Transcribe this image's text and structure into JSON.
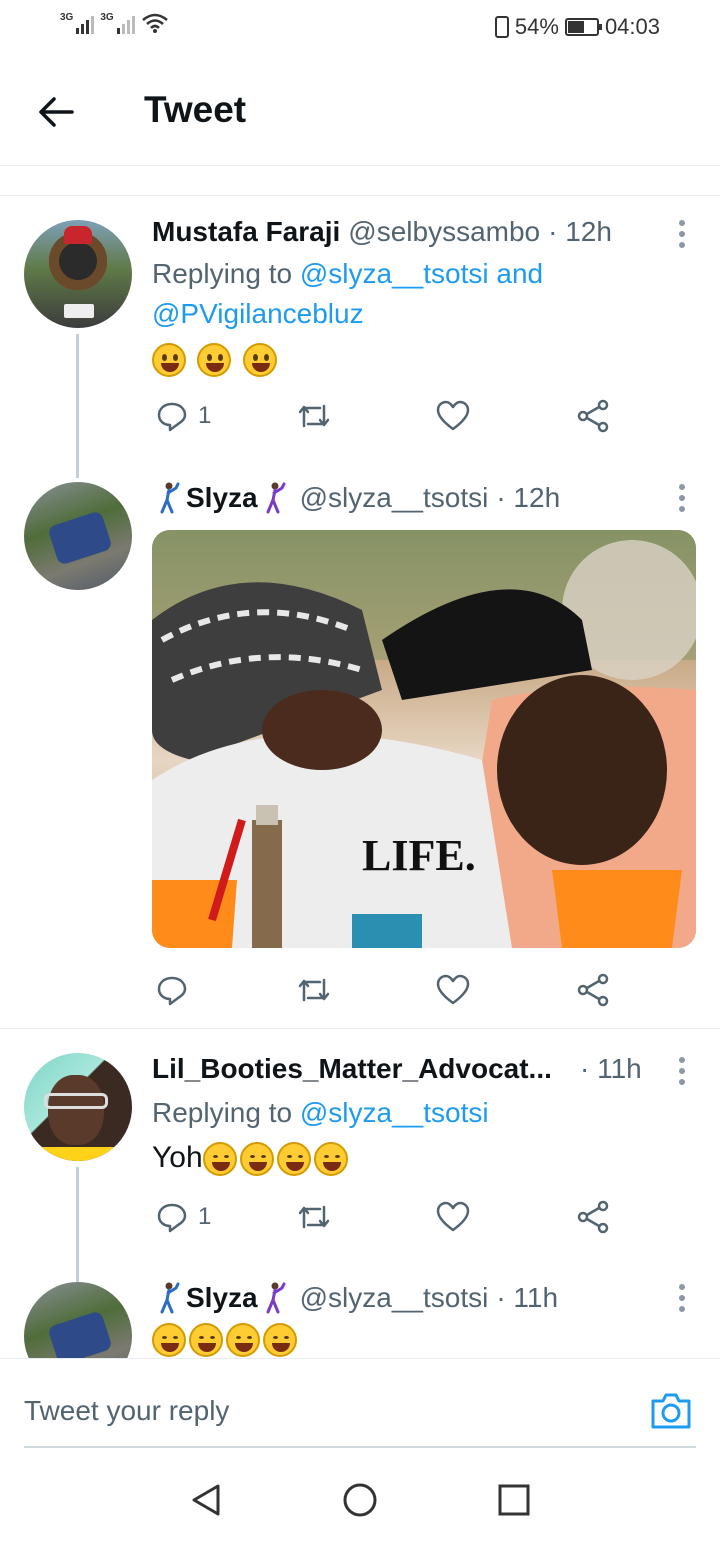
{
  "status_bar": {
    "sim1": "3G",
    "sim2": "3G",
    "battery": "54%",
    "battery_level": 0.54,
    "time": "04:03"
  },
  "header": {
    "title": "Tweet"
  },
  "tweets": [
    {
      "name": "Mustafa Faraji",
      "handle": "@selbyssambo",
      "time": "· 12h",
      "reply_prefix": "Replying to",
      "mention_line1": "@slyza__tsotsi and",
      "mention_line2": "@PVigilancebluz",
      "reply_count": "1"
    },
    {
      "name": "Slyza",
      "handle": "@slyza__tsotsi",
      "time": "· 12h"
    },
    {
      "name": "Lil_Booties_Matter_Advocat...",
      "time": "· 11h",
      "reply_prefix": "Replying to",
      "mention_line1": "@slyza__tsotsi",
      "text": "Yoh",
      "reply_count": "1"
    },
    {
      "name": "Slyza",
      "handle": "@slyza__tsotsi",
      "time": "· 11h"
    }
  ],
  "reply_bar": {
    "placeholder": "Tweet your reply"
  },
  "icons": {
    "back": "arrow-left-icon",
    "reply": "reply-icon",
    "retweet": "retweet-icon",
    "like": "heart-icon",
    "share": "share-icon",
    "camera": "camera-icon"
  },
  "colors": {
    "accent": "#1d9bf0",
    "secondary_text": "#536471"
  }
}
